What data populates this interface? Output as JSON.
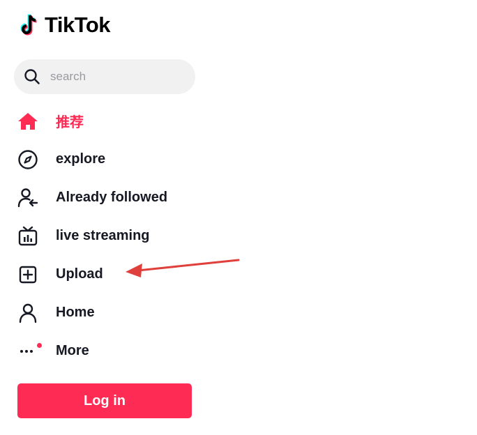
{
  "brand": {
    "name": "TikTok",
    "accent": "#fe2c55"
  },
  "search": {
    "placeholder": "search",
    "icon": "search-icon"
  },
  "nav": {
    "items": [
      {
        "label": "推荐",
        "icon": "home-icon",
        "active": true
      },
      {
        "label": "explore",
        "icon": "compass-icon"
      },
      {
        "label": "Already followed",
        "icon": "following-icon"
      },
      {
        "label": "live streaming",
        "icon": "live-tv-icon"
      },
      {
        "label": "Upload",
        "icon": "upload-plus-icon"
      },
      {
        "label": "Home",
        "icon": "profile-icon"
      },
      {
        "label": "More",
        "icon": "more-dots-icon"
      }
    ]
  },
  "auth": {
    "login_label": "Log in"
  },
  "annotation": {
    "color": "#e0403c"
  }
}
